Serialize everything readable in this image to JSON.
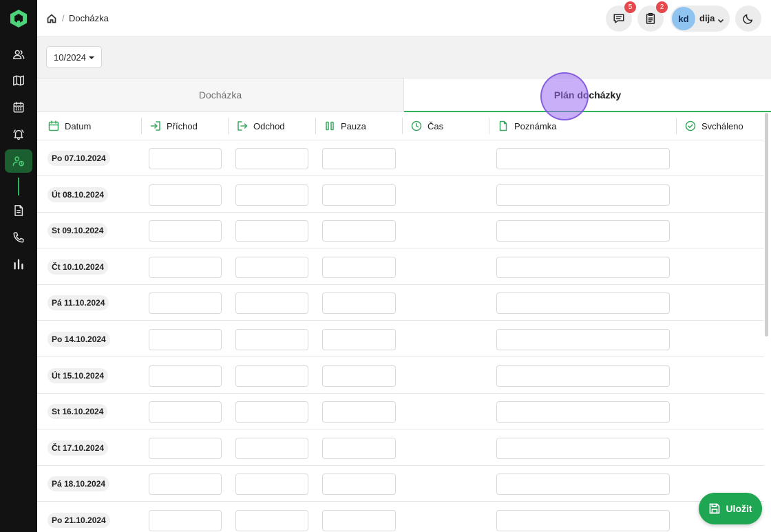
{
  "sidebar": {
    "items": [
      {
        "icon": "users-icon"
      },
      {
        "icon": "map-icon"
      },
      {
        "icon": "calendar-icon"
      },
      {
        "icon": "bell-icon"
      },
      {
        "icon": "user-clock-icon",
        "active": true
      },
      {
        "icon": "document-icon"
      },
      {
        "icon": "phone-icon"
      },
      {
        "icon": "bar-chart-icon"
      }
    ]
  },
  "header": {
    "breadcrumb_sep": "/",
    "breadcrumb_page": "Docházka",
    "messages_badge": "5",
    "tasks_badge": "2",
    "user_initials": "kd",
    "user_name": "dija"
  },
  "filters": {
    "month": "10/2024"
  },
  "tabs": [
    {
      "label": "Docházka",
      "active": false
    },
    {
      "label": "Plán docházky",
      "active": true
    }
  ],
  "table": {
    "columns": [
      "Datum",
      "Příchod",
      "Odchod",
      "Pauza",
      "Čas",
      "Poznámka",
      "Svcháleno"
    ],
    "rows": [
      "Po 07.10.2024",
      "Út 08.10.2024",
      "St 09.10.2024",
      "Čt 10.10.2024",
      "Pá 11.10.2024",
      "Po 14.10.2024",
      "Út 15.10.2024",
      "St 16.10.2024",
      "Čt 17.10.2024",
      "Pá 18.10.2024",
      "Po 21.10.2024"
    ]
  },
  "actions": {
    "save_label": "Uložit"
  },
  "colors": {
    "accent": "#2fb35a",
    "sidebar_bg": "#121212",
    "badge": "#e5484d",
    "save_button": "#1fa653"
  }
}
